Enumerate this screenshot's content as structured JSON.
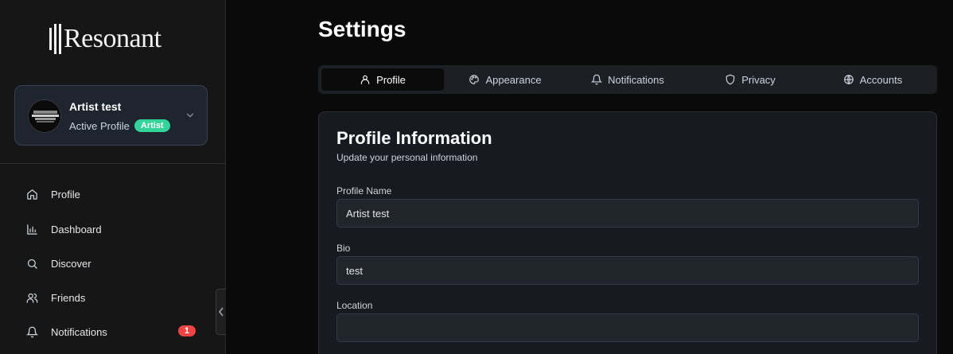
{
  "app": {
    "logo_text": "Resonant"
  },
  "profile_card": {
    "name": "Artist test",
    "subtitle": "Active Profile",
    "badge": "Artist"
  },
  "sidebar": {
    "items": [
      {
        "label": "Profile",
        "icon": "home-icon"
      },
      {
        "label": "Dashboard",
        "icon": "bar-chart-icon"
      },
      {
        "label": "Discover",
        "icon": "search-icon"
      },
      {
        "label": "Friends",
        "icon": "users-icon"
      },
      {
        "label": "Notifications",
        "icon": "bell-icon",
        "badge": "1"
      }
    ]
  },
  "page": {
    "title": "Settings"
  },
  "tabs": [
    {
      "label": "Profile",
      "icon": "user-icon",
      "active": true
    },
    {
      "label": "Appearance",
      "icon": "palette-icon"
    },
    {
      "label": "Notifications",
      "icon": "bell-icon"
    },
    {
      "label": "Privacy",
      "icon": "shield-icon"
    },
    {
      "label": "Accounts",
      "icon": "globe-icon"
    }
  ],
  "panel": {
    "title": "Profile Information",
    "subtitle": "Update your personal information",
    "fields": [
      {
        "label": "Profile Name",
        "value": "Artist test"
      },
      {
        "label": "Bio",
        "value": "test"
      },
      {
        "label": "Location",
        "value": ""
      }
    ]
  },
  "colors": {
    "accent_green": "#34d399",
    "badge_red": "#ef4444",
    "background": "#0a0a0a",
    "sidebar": "#161616"
  }
}
